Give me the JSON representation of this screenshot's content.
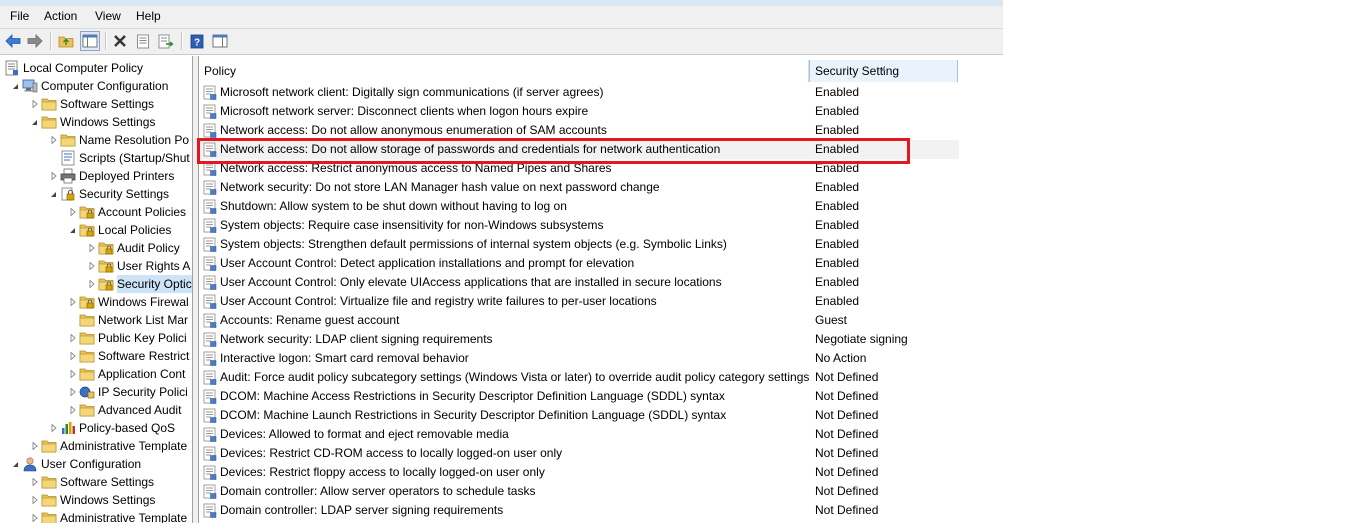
{
  "menu": {
    "file": "File",
    "action": "Action",
    "view": "View",
    "help": "Help"
  },
  "toolbar": {
    "icons": [
      "back-arrow-icon",
      "forward-arrow-icon",
      "up-folder-icon",
      "show-hide-tree-icon",
      "delete-icon",
      "properties-icon",
      "export-list-icon",
      "help-icon",
      "show-action-pane-icon"
    ]
  },
  "tree": {
    "items": [
      {
        "label": "Local Computer Policy",
        "depth": 0,
        "arrow": "",
        "icon": "policy-doc"
      },
      {
        "label": "Computer Configuration",
        "depth": 1,
        "arrow": "open",
        "icon": "computer"
      },
      {
        "label": "Software Settings",
        "depth": 2,
        "arrow": "closed",
        "icon": "folder"
      },
      {
        "label": "Windows Settings",
        "depth": 2,
        "arrow": "open",
        "icon": "folder"
      },
      {
        "label": "Name Resolution Po",
        "depth": 3,
        "arrow": "closed",
        "icon": "folder"
      },
      {
        "label": "Scripts (Startup/Shut",
        "depth": 3,
        "arrow": "",
        "icon": "script"
      },
      {
        "label": "Deployed Printers",
        "depth": 3,
        "arrow": "closed",
        "icon": "printer"
      },
      {
        "label": "Security Settings",
        "depth": 3,
        "arrow": "open",
        "icon": "security"
      },
      {
        "label": "Account Policies",
        "depth": 4,
        "arrow": "closed",
        "icon": "folder-lock"
      },
      {
        "label": "Local Policies",
        "depth": 4,
        "arrow": "open",
        "icon": "folder-lock"
      },
      {
        "label": "Audit Policy",
        "depth": 5,
        "arrow": "closed",
        "icon": "folder-lock"
      },
      {
        "label": "User Rights A",
        "depth": 5,
        "arrow": "closed",
        "icon": "folder-lock"
      },
      {
        "label": "Security Optic",
        "depth": 5,
        "arrow": "closed",
        "icon": "folder-lock",
        "selected": true
      },
      {
        "label": "Windows Firewal",
        "depth": 4,
        "arrow": "closed",
        "icon": "folder-lock"
      },
      {
        "label": "Network List Mar",
        "depth": 4,
        "arrow": "",
        "icon": "folder"
      },
      {
        "label": "Public Key Polici",
        "depth": 4,
        "arrow": "closed",
        "icon": "folder"
      },
      {
        "label": "Software Restrict",
        "depth": 4,
        "arrow": "closed",
        "icon": "folder"
      },
      {
        "label": "Application Cont",
        "depth": 4,
        "arrow": "closed",
        "icon": "folder"
      },
      {
        "label": "IP Security Polici",
        "depth": 4,
        "arrow": "closed",
        "icon": "ipsec"
      },
      {
        "label": "Advanced Audit",
        "depth": 4,
        "arrow": "closed",
        "icon": "folder"
      },
      {
        "label": "Policy-based QoS",
        "depth": 3,
        "arrow": "closed",
        "icon": "chart"
      },
      {
        "label": "Administrative Template",
        "depth": 2,
        "arrow": "closed",
        "icon": "folder"
      },
      {
        "label": "User Configuration",
        "depth": 1,
        "arrow": "open",
        "icon": "user"
      },
      {
        "label": "Software Settings",
        "depth": 2,
        "arrow": "closed",
        "icon": "folder"
      },
      {
        "label": "Windows Settings",
        "depth": 2,
        "arrow": "closed",
        "icon": "folder"
      },
      {
        "label": "Administrative Template",
        "depth": 2,
        "arrow": "closed",
        "icon": "folder"
      }
    ]
  },
  "list": {
    "columns": {
      "policy": "Policy",
      "setting": "Security Setting"
    },
    "rows": [
      {
        "policy": "Microsoft network client: Digitally sign communications (if server agrees)",
        "setting": "Enabled"
      },
      {
        "policy": "Microsoft network server: Disconnect clients when logon hours expire",
        "setting": "Enabled"
      },
      {
        "policy": "Network access: Do not allow anonymous enumeration of SAM accounts",
        "setting": "Enabled"
      },
      {
        "policy": "Network access: Do not allow storage of passwords and credentials for network authentication",
        "setting": "Enabled",
        "selected": true
      },
      {
        "policy": "Network access: Restrict anonymous access to Named Pipes and Shares",
        "setting": "Enabled"
      },
      {
        "policy": "Network security: Do not store LAN Manager hash value on next password change",
        "setting": "Enabled"
      },
      {
        "policy": "Shutdown: Allow system to be shut down without having to log on",
        "setting": "Enabled"
      },
      {
        "policy": "System objects: Require case insensitivity for non-Windows subsystems",
        "setting": "Enabled"
      },
      {
        "policy": "System objects: Strengthen default permissions of internal system objects (e.g. Symbolic Links)",
        "setting": "Enabled"
      },
      {
        "policy": "User Account Control: Detect application installations and prompt for elevation",
        "setting": "Enabled"
      },
      {
        "policy": "User Account Control: Only elevate UIAccess applications that are installed in secure locations",
        "setting": "Enabled"
      },
      {
        "policy": "User Account Control: Virtualize file and registry write failures to per-user locations",
        "setting": "Enabled"
      },
      {
        "policy": "Accounts: Rename guest account",
        "setting": "Guest"
      },
      {
        "policy": "Network security: LDAP client signing requirements",
        "setting": "Negotiate signing"
      },
      {
        "policy": "Interactive logon: Smart card removal behavior",
        "setting": "No Action"
      },
      {
        "policy": "Audit: Force audit policy subcategory settings (Windows Vista or later) to override audit policy category settings",
        "setting": "Not Defined"
      },
      {
        "policy": "DCOM: Machine Access Restrictions in Security Descriptor Definition Language (SDDL) syntax",
        "setting": "Not Defined"
      },
      {
        "policy": "DCOM: Machine Launch Restrictions in Security Descriptor Definition Language (SDDL) syntax",
        "setting": "Not Defined"
      },
      {
        "policy": "Devices: Allowed to format and eject removable media",
        "setting": "Not Defined"
      },
      {
        "policy": "Devices: Restrict CD-ROM access to locally logged-on user only",
        "setting": "Not Defined"
      },
      {
        "policy": "Devices: Restrict floppy access to locally logged-on user only",
        "setting": "Not Defined"
      },
      {
        "policy": "Domain controller: Allow server operators to schedule tasks",
        "setting": "Not Defined"
      },
      {
        "policy": "Domain controller: LDAP server signing requirements",
        "setting": "Not Defined"
      }
    ]
  },
  "colors": {
    "highlight_border": "#e4161f",
    "selection_bg": "#cde3f7",
    "folder": "#e8c25a"
  }
}
